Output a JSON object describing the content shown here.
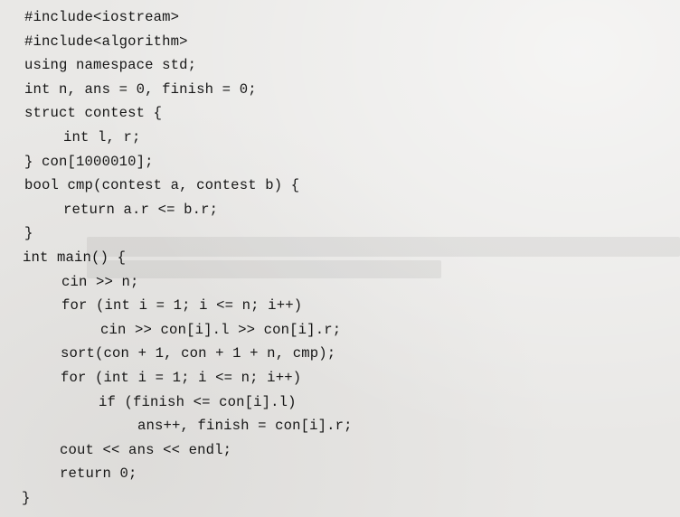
{
  "code": {
    "lines": [
      {
        "indent": 0,
        "text": "#include<iostream>"
      },
      {
        "indent": 0,
        "text": "#include<algorithm>"
      },
      {
        "indent": 0,
        "text": "using namespace std;"
      },
      {
        "indent": 0,
        "text": "int n, ans = 0, finish = 0;"
      },
      {
        "indent": 0,
        "text": "struct contest {"
      },
      {
        "indent": 1,
        "text": "int l, r;"
      },
      {
        "indent": 0,
        "text": "} con[1000010];"
      },
      {
        "indent": 0,
        "text": "bool cmp(contest a, contest b) {"
      },
      {
        "indent": 1,
        "text": "return a.r <= b.r;"
      },
      {
        "indent": 0,
        "text": "}"
      },
      {
        "indent": 0,
        "text": "int main() {"
      },
      {
        "indent": 1,
        "text": "cin >> n;"
      },
      {
        "indent": 1,
        "text": "for (int i = 1; i <= n; i++)"
      },
      {
        "indent": 2,
        "text": "cin >> con[i].l >> con[i].r;"
      },
      {
        "indent": 1,
        "text": "sort(con + 1, con + 1 + n, cmp);"
      },
      {
        "indent": 1,
        "text": "for (int i = 1; i <= n; i++)"
      },
      {
        "indent": 2,
        "text": "if (finish <= con[i].l)"
      },
      {
        "indent": 3,
        "text": "ans++, finish = con[i].r;"
      },
      {
        "indent": 1,
        "text": "cout << ans << endl;"
      },
      {
        "indent": 1,
        "text": "return 0;"
      },
      {
        "indent": 0,
        "text": "}"
      }
    ]
  }
}
